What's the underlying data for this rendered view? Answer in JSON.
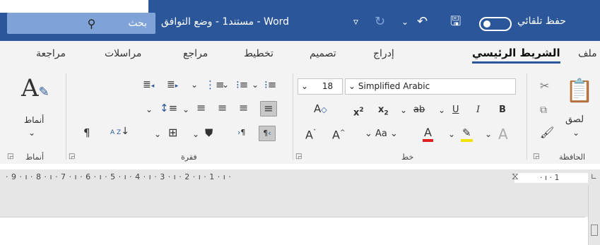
{
  "titlebar": {
    "search_label": "بحث",
    "search_icon": "search-icon",
    "title": "مستند1  -  وضع التوافق  -  Word",
    "autosave_label": "حفظ تلقائي",
    "colors": {
      "bar": "#2b579a",
      "search": "#7fa3d6"
    }
  },
  "tabs": [
    {
      "label": "ملف"
    },
    {
      "label": "الشريط الرئيسي",
      "active": true
    },
    {
      "label": "إدراج"
    },
    {
      "label": "تصميم"
    },
    {
      "label": "تخطيط"
    },
    {
      "label": "مراجع"
    },
    {
      "label": "مراسلات"
    },
    {
      "label": "مراجعة"
    }
  ],
  "groups": {
    "clipboard": {
      "label": "الحافظة",
      "paste_label": "لصق"
    },
    "font": {
      "label": "خط",
      "font_name": "Simplified Arabic",
      "font_size": "18"
    },
    "paragraph": {
      "label": "فقرة"
    },
    "styles": {
      "label": "أنماط",
      "styles_label": "أنماط"
    }
  },
  "ruler": {
    "marks": "· 9 · ı · 8 · ı · 7 · ı · 6 · ı · 5 · ı · 4 · ı · 3 · ı · 2 · ı · 1 · ı ·",
    "right_mark": "· ı · 1"
  }
}
